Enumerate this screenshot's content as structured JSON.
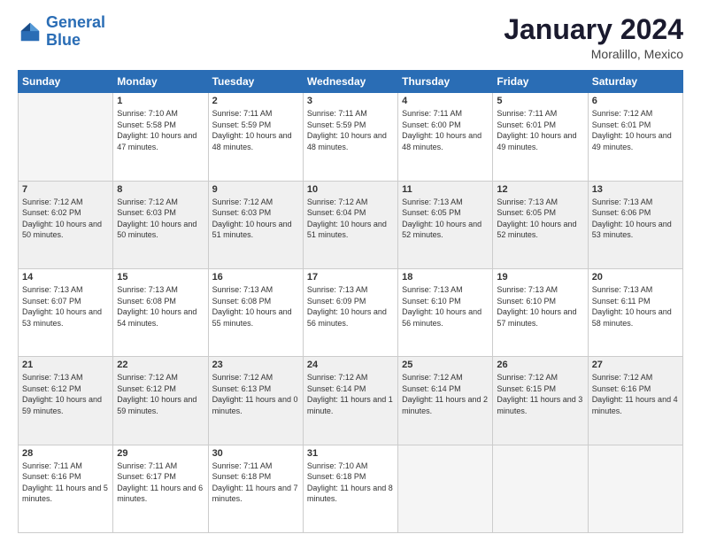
{
  "header": {
    "logo_line1": "General",
    "logo_line2": "Blue",
    "title": "January 2024",
    "subtitle": "Moralillo, Mexico"
  },
  "days_of_week": [
    "Sunday",
    "Monday",
    "Tuesday",
    "Wednesday",
    "Thursday",
    "Friday",
    "Saturday"
  ],
  "weeks": [
    [
      {
        "day": "",
        "sunrise": "",
        "sunset": "",
        "daylight": ""
      },
      {
        "day": "1",
        "sunrise": "Sunrise: 7:10 AM",
        "sunset": "Sunset: 5:58 PM",
        "daylight": "Daylight: 10 hours and 47 minutes."
      },
      {
        "day": "2",
        "sunrise": "Sunrise: 7:11 AM",
        "sunset": "Sunset: 5:59 PM",
        "daylight": "Daylight: 10 hours and 48 minutes."
      },
      {
        "day": "3",
        "sunrise": "Sunrise: 7:11 AM",
        "sunset": "Sunset: 5:59 PM",
        "daylight": "Daylight: 10 hours and 48 minutes."
      },
      {
        "day": "4",
        "sunrise": "Sunrise: 7:11 AM",
        "sunset": "Sunset: 6:00 PM",
        "daylight": "Daylight: 10 hours and 48 minutes."
      },
      {
        "day": "5",
        "sunrise": "Sunrise: 7:11 AM",
        "sunset": "Sunset: 6:01 PM",
        "daylight": "Daylight: 10 hours and 49 minutes."
      },
      {
        "day": "6",
        "sunrise": "Sunrise: 7:12 AM",
        "sunset": "Sunset: 6:01 PM",
        "daylight": "Daylight: 10 hours and 49 minutes."
      }
    ],
    [
      {
        "day": "7",
        "sunrise": "Sunrise: 7:12 AM",
        "sunset": "Sunset: 6:02 PM",
        "daylight": "Daylight: 10 hours and 50 minutes."
      },
      {
        "day": "8",
        "sunrise": "Sunrise: 7:12 AM",
        "sunset": "Sunset: 6:03 PM",
        "daylight": "Daylight: 10 hours and 50 minutes."
      },
      {
        "day": "9",
        "sunrise": "Sunrise: 7:12 AM",
        "sunset": "Sunset: 6:03 PM",
        "daylight": "Daylight: 10 hours and 51 minutes."
      },
      {
        "day": "10",
        "sunrise": "Sunrise: 7:12 AM",
        "sunset": "Sunset: 6:04 PM",
        "daylight": "Daylight: 10 hours and 51 minutes."
      },
      {
        "day": "11",
        "sunrise": "Sunrise: 7:13 AM",
        "sunset": "Sunset: 6:05 PM",
        "daylight": "Daylight: 10 hours and 52 minutes."
      },
      {
        "day": "12",
        "sunrise": "Sunrise: 7:13 AM",
        "sunset": "Sunset: 6:05 PM",
        "daylight": "Daylight: 10 hours and 52 minutes."
      },
      {
        "day": "13",
        "sunrise": "Sunrise: 7:13 AM",
        "sunset": "Sunset: 6:06 PM",
        "daylight": "Daylight: 10 hours and 53 minutes."
      }
    ],
    [
      {
        "day": "14",
        "sunrise": "Sunrise: 7:13 AM",
        "sunset": "Sunset: 6:07 PM",
        "daylight": "Daylight: 10 hours and 53 minutes."
      },
      {
        "day": "15",
        "sunrise": "Sunrise: 7:13 AM",
        "sunset": "Sunset: 6:08 PM",
        "daylight": "Daylight: 10 hours and 54 minutes."
      },
      {
        "day": "16",
        "sunrise": "Sunrise: 7:13 AM",
        "sunset": "Sunset: 6:08 PM",
        "daylight": "Daylight: 10 hours and 55 minutes."
      },
      {
        "day": "17",
        "sunrise": "Sunrise: 7:13 AM",
        "sunset": "Sunset: 6:09 PM",
        "daylight": "Daylight: 10 hours and 56 minutes."
      },
      {
        "day": "18",
        "sunrise": "Sunrise: 7:13 AM",
        "sunset": "Sunset: 6:10 PM",
        "daylight": "Daylight: 10 hours and 56 minutes."
      },
      {
        "day": "19",
        "sunrise": "Sunrise: 7:13 AM",
        "sunset": "Sunset: 6:10 PM",
        "daylight": "Daylight: 10 hours and 57 minutes."
      },
      {
        "day": "20",
        "sunrise": "Sunrise: 7:13 AM",
        "sunset": "Sunset: 6:11 PM",
        "daylight": "Daylight: 10 hours and 58 minutes."
      }
    ],
    [
      {
        "day": "21",
        "sunrise": "Sunrise: 7:13 AM",
        "sunset": "Sunset: 6:12 PM",
        "daylight": "Daylight: 10 hours and 59 minutes."
      },
      {
        "day": "22",
        "sunrise": "Sunrise: 7:12 AM",
        "sunset": "Sunset: 6:12 PM",
        "daylight": "Daylight: 10 hours and 59 minutes."
      },
      {
        "day": "23",
        "sunrise": "Sunrise: 7:12 AM",
        "sunset": "Sunset: 6:13 PM",
        "daylight": "Daylight: 11 hours and 0 minutes."
      },
      {
        "day": "24",
        "sunrise": "Sunrise: 7:12 AM",
        "sunset": "Sunset: 6:14 PM",
        "daylight": "Daylight: 11 hours and 1 minute."
      },
      {
        "day": "25",
        "sunrise": "Sunrise: 7:12 AM",
        "sunset": "Sunset: 6:14 PM",
        "daylight": "Daylight: 11 hours and 2 minutes."
      },
      {
        "day": "26",
        "sunrise": "Sunrise: 7:12 AM",
        "sunset": "Sunset: 6:15 PM",
        "daylight": "Daylight: 11 hours and 3 minutes."
      },
      {
        "day": "27",
        "sunrise": "Sunrise: 7:12 AM",
        "sunset": "Sunset: 6:16 PM",
        "daylight": "Daylight: 11 hours and 4 minutes."
      }
    ],
    [
      {
        "day": "28",
        "sunrise": "Sunrise: 7:11 AM",
        "sunset": "Sunset: 6:16 PM",
        "daylight": "Daylight: 11 hours and 5 minutes."
      },
      {
        "day": "29",
        "sunrise": "Sunrise: 7:11 AM",
        "sunset": "Sunset: 6:17 PM",
        "daylight": "Daylight: 11 hours and 6 minutes."
      },
      {
        "day": "30",
        "sunrise": "Sunrise: 7:11 AM",
        "sunset": "Sunset: 6:18 PM",
        "daylight": "Daylight: 11 hours and 7 minutes."
      },
      {
        "day": "31",
        "sunrise": "Sunrise: 7:10 AM",
        "sunset": "Sunset: 6:18 PM",
        "daylight": "Daylight: 11 hours and 8 minutes."
      },
      {
        "day": "",
        "sunrise": "",
        "sunset": "",
        "daylight": ""
      },
      {
        "day": "",
        "sunrise": "",
        "sunset": "",
        "daylight": ""
      },
      {
        "day": "",
        "sunrise": "",
        "sunset": "",
        "daylight": ""
      }
    ]
  ]
}
